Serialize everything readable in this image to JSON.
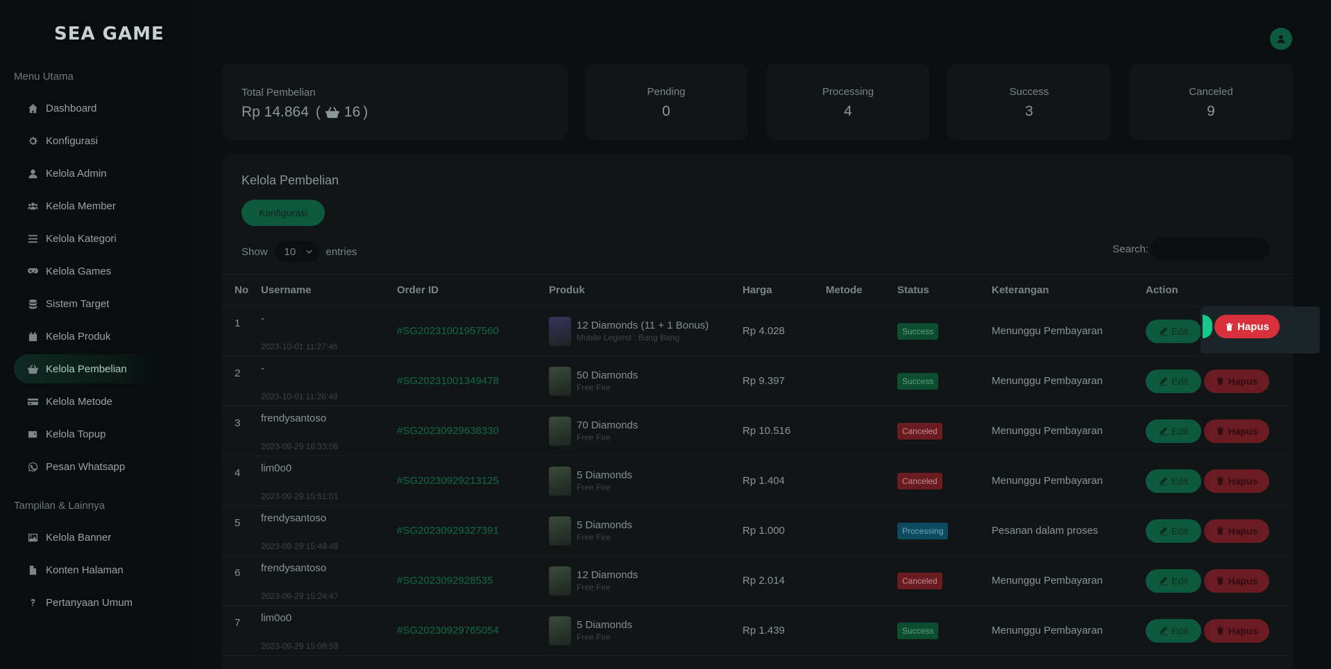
{
  "sidebar": {
    "logo": "SEA GAME",
    "section_main": "Menu Utama",
    "section_display": "Tampilan & Lainnya",
    "items": [
      {
        "label": "Dashboard",
        "icon": "home-icon"
      },
      {
        "label": "Konfigurasi",
        "icon": "gear-icon"
      },
      {
        "label": "Kelola Admin",
        "icon": "user-icon"
      },
      {
        "label": "Kelola Member",
        "icon": "users-icon"
      },
      {
        "label": "Kelola Kategori",
        "icon": "list-icon"
      },
      {
        "label": "Kelola Games",
        "icon": "gamepad-icon"
      },
      {
        "label": "Sistem Target",
        "icon": "database-icon"
      },
      {
        "label": "Kelola Produk",
        "icon": "calendar-icon"
      },
      {
        "label": "Kelola Pembelian",
        "icon": "basket-icon",
        "active": true
      },
      {
        "label": "Kelola Metode",
        "icon": "credit-card-icon"
      },
      {
        "label": "Kelola Topup",
        "icon": "wallet-icon"
      },
      {
        "label": "Pesan Whatsapp",
        "icon": "whatsapp-icon"
      }
    ],
    "items2": [
      {
        "label": "Kelola Banner",
        "icon": "image-icon"
      },
      {
        "label": "Konten Halaman",
        "icon": "file-icon"
      },
      {
        "label": "Pertanyaan Umum",
        "icon": "question-icon"
      }
    ]
  },
  "stats": {
    "total_title": "Total Pembelian",
    "total_amount": "Rp 14.864",
    "total_count": "16",
    "cards": [
      {
        "title": "Pending",
        "value": "0"
      },
      {
        "title": "Processing",
        "value": "4"
      },
      {
        "title": "Success",
        "value": "3"
      },
      {
        "title": "Canceled",
        "value": "9"
      }
    ]
  },
  "panel": {
    "title": "Kelola Pembelian",
    "config_button": "Konfigurasi",
    "show_label": "Show",
    "entries_value": "10",
    "entries_label": "entries",
    "search_label": "Search:",
    "columns": [
      "No",
      "Username",
      "Order ID",
      "Produk",
      "Harga",
      "Metode",
      "Status",
      "Keterangan",
      "Action"
    ],
    "rows": [
      {
        "no": "1",
        "user": "-",
        "date": "2023-10-01 11:27:46",
        "order": "#SG20231001957560",
        "product": "12 Diamonds (11 + 1 Bonus)",
        "game": "Mobile Legend : Bang Bang",
        "price": "Rp 4.028",
        "method": "",
        "status": "Success",
        "note": "Menunggu Pembayaran"
      },
      {
        "no": "2",
        "user": "-",
        "date": "2023-10-01 11:26:49",
        "order": "#SG20231001349478",
        "product": "50 Diamonds",
        "game": "Free Fire",
        "price": "Rp 9.397",
        "method": "",
        "status": "Success",
        "note": "Menunggu Pembayaran"
      },
      {
        "no": "3",
        "user": "frendysantoso",
        "date": "2023-09-29 16:33:06",
        "order": "#SG20230929638330",
        "product": "70 Diamonds",
        "game": "Free Fire",
        "price": "Rp 10.516",
        "method": "",
        "status": "Canceled",
        "note": "Menunggu Pembayaran"
      },
      {
        "no": "4",
        "user": "lim0o0",
        "date": "2023-09-29 15:51:01",
        "order": "#SG20230929213125",
        "product": "5 Diamonds",
        "game": "Free Fire",
        "price": "Rp 1.404",
        "method": "",
        "status": "Canceled",
        "note": "Menunggu Pembayaran"
      },
      {
        "no": "5",
        "user": "frendysantoso",
        "date": "2023-09-29 15:49:49",
        "order": "#SG20230929327391",
        "product": "5 Diamonds",
        "game": "Free Fire",
        "price": "Rp 1.000",
        "method": "",
        "status": "Processing",
        "note": "Pesanan dalam proses"
      },
      {
        "no": "6",
        "user": "frendysantoso",
        "date": "2023-09-29 15:24:47",
        "order": "#SG2023092928535",
        "product": "12 Diamonds",
        "game": "Free Fire",
        "price": "Rp 2.014",
        "method": "",
        "status": "Canceled",
        "note": "Menunggu Pembayaran"
      },
      {
        "no": "7",
        "user": "lim0o0",
        "date": "2023-09-29 15:08:59",
        "order": "#SG20230929765054",
        "product": "5 Diamonds",
        "game": "Free Fire",
        "price": "Rp 1.439",
        "method": "",
        "status": "Success",
        "note": "Menunggu Pembayaran"
      }
    ],
    "edit_label": "Edit",
    "delete_label": "Hapus"
  },
  "colors": {
    "accent": "#16c98a",
    "danger": "#d8313d",
    "background": "#0c0f10"
  }
}
